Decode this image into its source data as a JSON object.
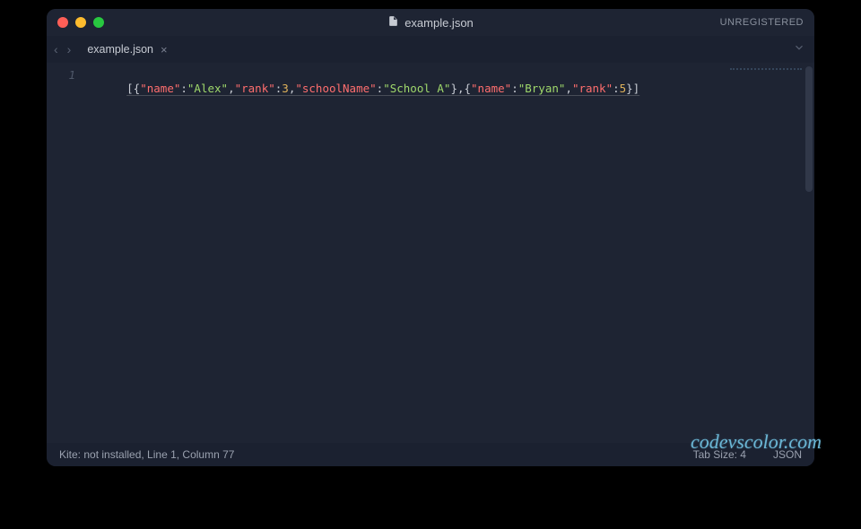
{
  "titlebar": {
    "filename": "example.json",
    "registration": "UNREGISTERED"
  },
  "tabs": {
    "active": "example.json"
  },
  "editor": {
    "line_number": "1",
    "tokens": [
      {
        "t": "[{",
        "c": "punct"
      },
      {
        "t": "\"name\"",
        "c": "key"
      },
      {
        "t": ":",
        "c": "punct"
      },
      {
        "t": "\"Alex\"",
        "c": "str"
      },
      {
        "t": ",",
        "c": "punct"
      },
      {
        "t": "\"rank\"",
        "c": "key"
      },
      {
        "t": ":",
        "c": "punct"
      },
      {
        "t": "3",
        "c": "num"
      },
      {
        "t": ",",
        "c": "punct"
      },
      {
        "t": "\"schoolName\"",
        "c": "key"
      },
      {
        "t": ":",
        "c": "punct"
      },
      {
        "t": "\"School A\"",
        "c": "str"
      },
      {
        "t": "},{",
        "c": "punct"
      },
      {
        "t": "\"name\"",
        "c": "key"
      },
      {
        "t": ":",
        "c": "punct"
      },
      {
        "t": "\"Bryan\"",
        "c": "str"
      },
      {
        "t": ",",
        "c": "punct"
      },
      {
        "t": "\"rank\"",
        "c": "key"
      },
      {
        "t": ":",
        "c": "punct"
      },
      {
        "t": "5",
        "c": "num"
      },
      {
        "t": "}]",
        "c": "punct"
      }
    ]
  },
  "status": {
    "left": "Kite: not installed, Line 1, Column 77",
    "tab_size": "Tab Size: 4",
    "syntax": "JSON"
  },
  "watermark": "codevscolor.com"
}
